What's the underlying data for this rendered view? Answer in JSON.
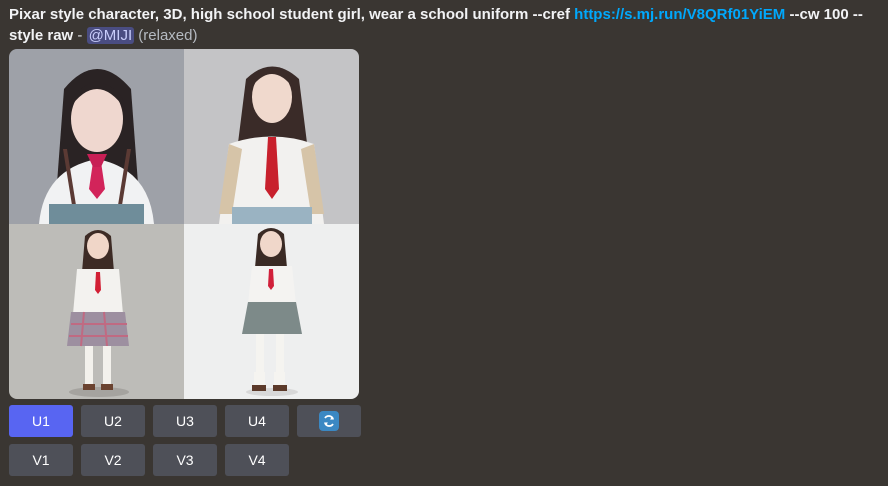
{
  "message": {
    "prompt_text": "Pixar style character, 3D, high school student girl, wear a school uniform --cref",
    "link_text": "https://s.mj.run/V8QRf01YiEM",
    "params_text": "--cw 100 --style raw",
    "separator": "-",
    "mention": "@MIJI",
    "status": "(relaxed)"
  },
  "image_grid": {
    "cells": [
      {
        "subject": "close-up girl in school uniform"
      },
      {
        "subject": "half-body girl with red tie"
      },
      {
        "subject": "full-body girl plaid skirt"
      },
      {
        "subject": "full-body girl gray skirt"
      }
    ]
  },
  "buttons": {
    "upscale": [
      "U1",
      "U2",
      "U3",
      "U4"
    ],
    "variation": [
      "V1",
      "V2",
      "V3",
      "V4"
    ],
    "reroll_icon": "refresh-icon",
    "colors": {
      "primary": "#5865f2",
      "secondary": "#4e5058",
      "reroll": "#3b88c3"
    }
  }
}
